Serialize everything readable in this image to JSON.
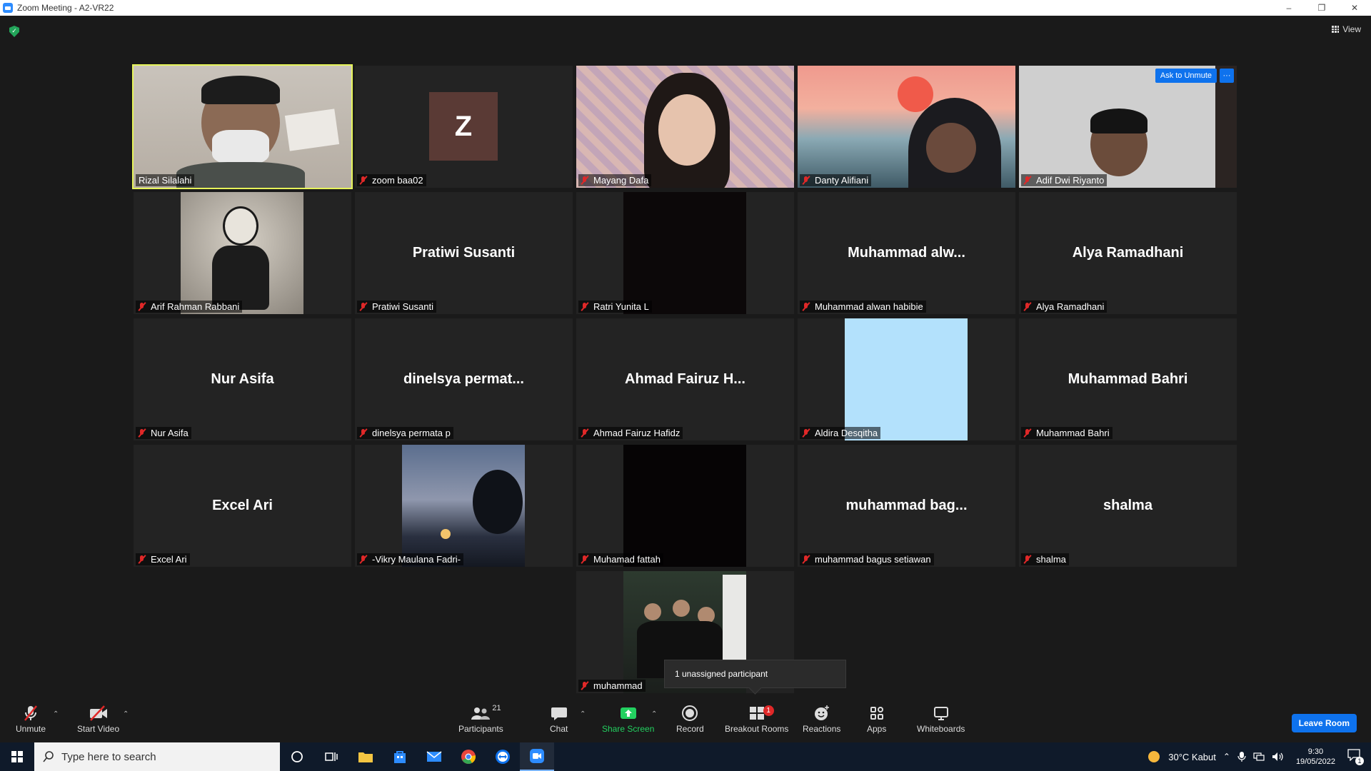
{
  "window": {
    "title": "Zoom Meeting - A2-VR22",
    "minimize": "–",
    "restore": "❐",
    "close": "✕"
  },
  "top": {
    "view_label": "View"
  },
  "tiles": [
    {
      "name": "Rizal Silalahi",
      "muted": false,
      "active": true
    },
    {
      "name": "zoom baa02",
      "muted": true,
      "avatar_letter": "Z"
    },
    {
      "name": "Mayang Dafa",
      "muted": true
    },
    {
      "name": "Danty Alifiani",
      "muted": true
    },
    {
      "name": "Adif Dwi Riyanto",
      "muted": true,
      "ask_unmute": "Ask to Unmute",
      "more": "···"
    },
    {
      "name": "Arif Rahman Rabbani",
      "muted": true
    },
    {
      "name": "Pratiwi Susanti",
      "muted": true,
      "big": "Pratiwi Susanti"
    },
    {
      "name": "Ratri Yunita L",
      "muted": true
    },
    {
      "name": "Muhammad alwan habibie",
      "muted": true,
      "big": "Muhammad alw..."
    },
    {
      "name": "Alya Ramadhani",
      "muted": true,
      "big": "Alya Ramadhani"
    },
    {
      "name": "Nur Asifa",
      "muted": true,
      "big": "Nur Asifa"
    },
    {
      "name": "dinelsya permata p",
      "muted": true,
      "big": "dinelsya permat..."
    },
    {
      "name": "Ahmad Fairuz Hafidz",
      "muted": true,
      "big": "Ahmad Fairuz H..."
    },
    {
      "name": "Aldira Desqitha",
      "muted": true
    },
    {
      "name": "Muhammad Bahri",
      "muted": true,
      "big": "Muhammad Bahri"
    },
    {
      "name": "Excel Ari",
      "muted": true,
      "big": "Excel Ari"
    },
    {
      "name": "-Vikry Maulana Fadri-",
      "muted": true
    },
    {
      "name": "Muhamad fattah",
      "muted": true
    },
    {
      "name": "muhammad bagus setiawan",
      "muted": true,
      "big": "muhammad bag..."
    },
    {
      "name": "shalma",
      "muted": true,
      "big": "shalma"
    },
    {
      "name": "muhammad",
      "muted": true
    }
  ],
  "tooltip": "1 unassigned participant",
  "toolbar": {
    "unmute": "Unmute",
    "start_video": "Start Video",
    "participants": "Participants",
    "participants_count": "21",
    "chat": "Chat",
    "share_screen": "Share Screen",
    "record": "Record",
    "breakout_rooms": "Breakout Rooms",
    "breakout_badge": "1",
    "reactions": "Reactions",
    "apps": "Apps",
    "whiteboards": "Whiteboards",
    "leave_room": "Leave Room",
    "caret": "⌃"
  },
  "taskbar": {
    "search_placeholder": "Type here to search",
    "weather": "30°C  Kabut",
    "time": "9:30",
    "date": "19/05/2022",
    "notif_count": "1"
  },
  "colors": {
    "accent": "#0e72ed",
    "active_speaker": "#e7f55a",
    "muted": "#e02828",
    "share": "#23d160"
  }
}
